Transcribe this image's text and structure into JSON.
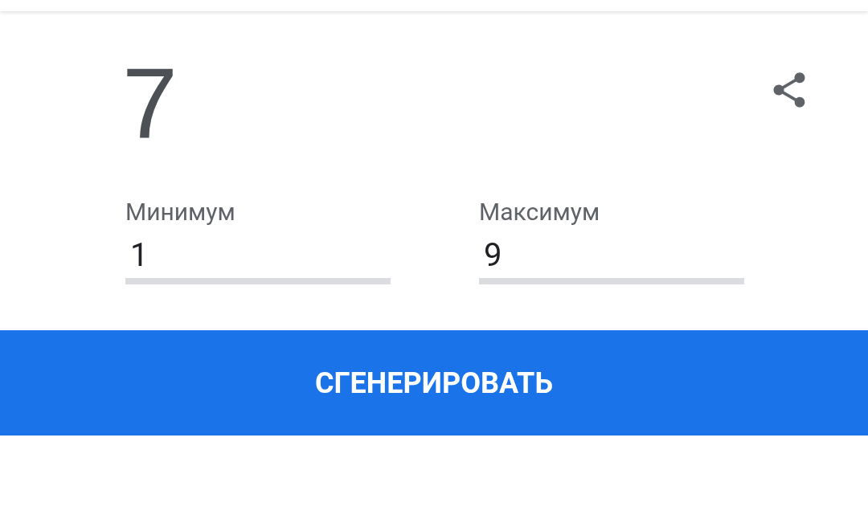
{
  "result": "7",
  "fields": [
    {
      "label": "Минимум",
      "value": "1"
    },
    {
      "label": "Максимум",
      "value": "9"
    }
  ],
  "button": "СГЕНЕРИРОВАТЬ"
}
